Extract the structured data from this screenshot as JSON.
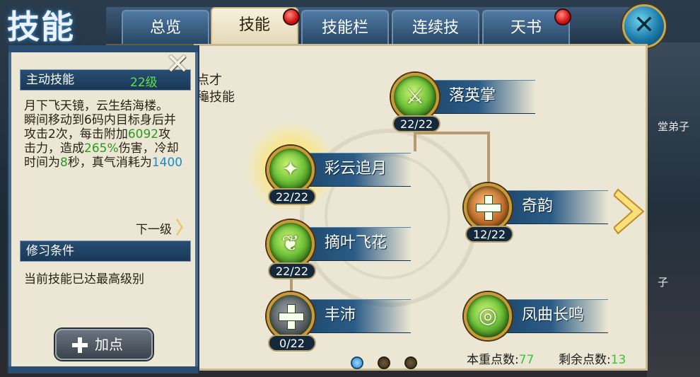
{
  "title": "技能",
  "tabs": [
    {
      "label": "总览",
      "badge": false
    },
    {
      "label": "技能",
      "badge": true,
      "active": true
    },
    {
      "label": "技能栏",
      "badge": false
    },
    {
      "label": "连续技",
      "badge": false
    },
    {
      "label": "天书",
      "badge": true
    }
  ],
  "info_panel": {
    "skill_type": "主动技能",
    "skill_level": "22级",
    "desc": {
      "l1": "月下飞天镜，云生结海楼。",
      "l2": "瞬间移动到6码内目标身后并",
      "l3a": "攻击2次，每击附加",
      "l3b": "6092",
      "l3c": "攻",
      "l4a": "击力，造成",
      "l4b": "265%",
      "l4c": "伤害，冷却",
      "l5a": "时间为",
      "l5b": "8",
      "l5c": "秒，真气消耗为",
      "l5d": "1400"
    },
    "next_level": "下一级",
    "requirement_header": "修习条件",
    "requirement_text": "当前技能已达最高级别",
    "add_point_button": "加点"
  },
  "partial_text": {
    "l1": "点才",
    "l2": "龝技能"
  },
  "skills": [
    {
      "name": "落英掌",
      "level": "22/22",
      "icon": "crossed-swords-icon"
    },
    {
      "name": "彩云追月",
      "level": "22/22",
      "icon": "leaping-figure-icon",
      "highlighted": true
    },
    {
      "name": "奇韵",
      "level": "12/22",
      "icon": "plus-icon"
    },
    {
      "name": "摘叶飞花",
      "level": "22/22",
      "icon": "flying-leaves-icon"
    },
    {
      "name": "丰沛",
      "level": "0/22",
      "icon": "plus-icon"
    },
    {
      "name": "凤曲长鸣",
      "level": "",
      "icon": "green-swirl-icon"
    }
  ],
  "points": {
    "current_label": "本重点数:",
    "current_value": "77",
    "remaining_label": "剩余点数:",
    "remaining_value": "13"
  },
  "pagination": {
    "pages": 3,
    "active": 1
  },
  "background_text": {
    "r1": "堂弟子",
    "r2": "子"
  },
  "colors": {
    "accent_blue": "#2a5a82",
    "value_green": "#3ac43a",
    "badge_red": "#d21414",
    "panel_bg": "#ece7d4"
  }
}
